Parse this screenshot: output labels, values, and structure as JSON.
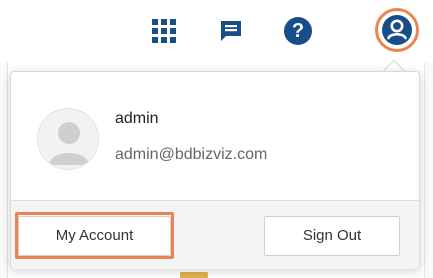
{
  "toolbar": {
    "apps_icon": "apps-grid-icon",
    "chat_icon": "chat-icon",
    "help_icon": "help-icon",
    "help_glyph": "?",
    "user_icon": "user-circle-icon",
    "icon_color": "#174e87",
    "highlight_color": "#e98552"
  },
  "profile_menu": {
    "username": "admin",
    "email": "admin@bdbizviz.com",
    "avatar_icon": "user-avatar-icon",
    "my_account_label": "My Account",
    "sign_out_label": "Sign Out"
  }
}
